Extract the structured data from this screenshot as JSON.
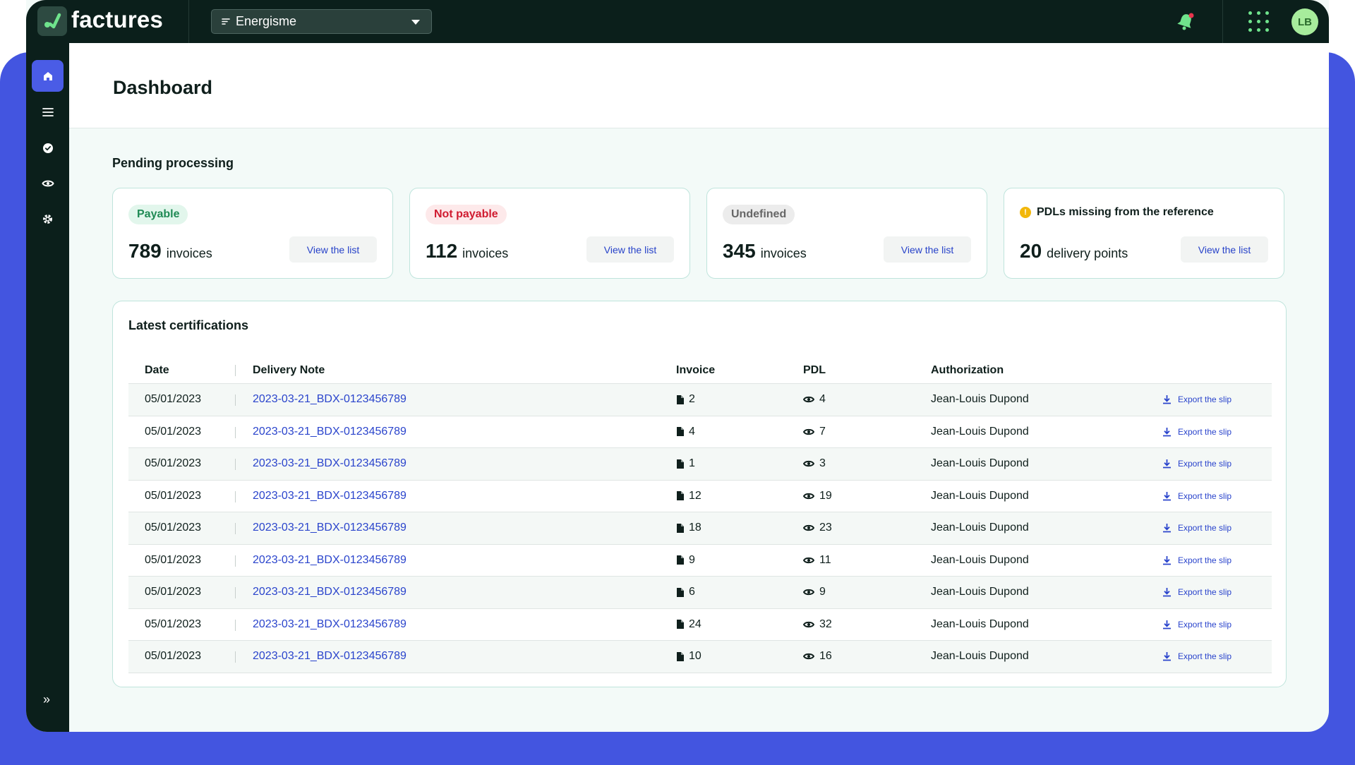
{
  "app": {
    "logo_text": "factures"
  },
  "topbar": {
    "organization": "Energisme",
    "avatar_initials": "LB"
  },
  "page": {
    "title": "Dashboard"
  },
  "pending": {
    "title": "Pending processing",
    "cards": [
      {
        "pill": "Payable",
        "count": "789",
        "unit": "invoices",
        "button": "View the list"
      },
      {
        "pill": "Not payable",
        "count": "112",
        "unit": "invoices",
        "button": "View the list"
      },
      {
        "pill": "Undefined",
        "count": "345",
        "unit": "invoices",
        "button": "View the list"
      },
      {
        "warning": "PDLs missing from the reference",
        "count": "20",
        "unit": "delivery points",
        "button": "View the list"
      }
    ]
  },
  "certifications": {
    "title": "Latest certifications",
    "columns": [
      "Date",
      "Delivery Note",
      "Invoice",
      "PDL",
      "Authorization"
    ],
    "export_label": "Export the slip",
    "rows": [
      {
        "date": "05/01/2023",
        "note": "2023-03-21_BDX-0123456789",
        "invoice": "2",
        "pdl": "4",
        "auth": "Jean-Louis Dupond"
      },
      {
        "date": "05/01/2023",
        "note": "2023-03-21_BDX-0123456789",
        "invoice": "4",
        "pdl": "7",
        "auth": "Jean-Louis Dupond"
      },
      {
        "date": "05/01/2023",
        "note": "2023-03-21_BDX-0123456789",
        "invoice": "1",
        "pdl": "3",
        "auth": "Jean-Louis Dupond"
      },
      {
        "date": "05/01/2023",
        "note": "2023-03-21_BDX-0123456789",
        "invoice": "12",
        "pdl": "19",
        "auth": "Jean-Louis Dupond"
      },
      {
        "date": "05/01/2023",
        "note": "2023-03-21_BDX-0123456789",
        "invoice": "18",
        "pdl": "23",
        "auth": "Jean-Louis Dupond"
      },
      {
        "date": "05/01/2023",
        "note": "2023-03-21_BDX-0123456789",
        "invoice": "9",
        "pdl": "11",
        "auth": "Jean-Louis Dupond"
      },
      {
        "date": "05/01/2023",
        "note": "2023-03-21_BDX-0123456789",
        "invoice": "6",
        "pdl": "9",
        "auth": "Jean-Louis Dupond"
      },
      {
        "date": "05/01/2023",
        "note": "2023-03-21_BDX-0123456789",
        "invoice": "24",
        "pdl": "32",
        "auth": "Jean-Louis Dupond"
      },
      {
        "date": "05/01/2023",
        "note": "2023-03-21_BDX-0123456789",
        "invoice": "10",
        "pdl": "16",
        "auth": "Jean-Louis Dupond"
      }
    ]
  },
  "colors": {
    "accent": "#4355e0",
    "dark": "#0b1f1b",
    "link": "#2a44cc",
    "success": "#1f8a54",
    "danger": "#d01b30",
    "warning": "#f2b70a"
  },
  "icons": [
    "logo-icon",
    "filter-lines-icon",
    "chevron-down-icon",
    "bell-icon",
    "apps-grid-icon",
    "home-icon",
    "menu-icon",
    "check-circle-icon",
    "eye-icon",
    "gear-icon",
    "chevrons-right-icon",
    "file-icon",
    "download-icon",
    "warning-icon"
  ]
}
